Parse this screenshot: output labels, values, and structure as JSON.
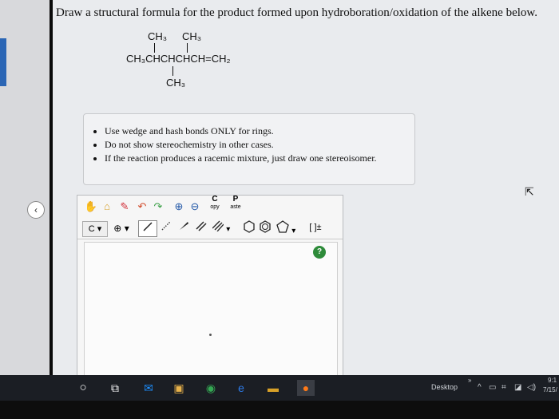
{
  "question": "Draw a structural formula for the product formed upon hydroboration/oxidation of the alkene below.",
  "formula": {
    "top_left": "CH₃",
    "top_right": "CH₃",
    "main_chain": "CH₃CHCHCHCH=CH₂",
    "bottom": "CH₃"
  },
  "instructions": [
    "Use wedge and hash bonds ONLY for rings.",
    "Do not show stereochemistry in other cases.",
    "If the reaction produces a racemic mixture, just draw one stereoisomer."
  ],
  "toolbar": {
    "copy_top": "C",
    "copy_bottom": "opy",
    "paste_top": "P",
    "paste_bottom": "aste",
    "element_label": "C",
    "element_arrow": "▾",
    "charge_plus": "⊕",
    "charge_arrow": "▾",
    "bracket_label": "[ ]±",
    "ring_arrow": "▾",
    "bond_arrow": "▾"
  },
  "editor": {
    "help_label": "?"
  },
  "taskbar": {
    "desktop_label": "Desktop",
    "chevron": "»",
    "caret": "^",
    "time": "9:1",
    "date": "7/15/"
  },
  "sidebar": {
    "collapse_glyph": "‹"
  },
  "colors": {
    "help_green": "#2e8b3a",
    "taskbar_bg": "#1b1e24",
    "accent_blue": "#2b66b5"
  }
}
